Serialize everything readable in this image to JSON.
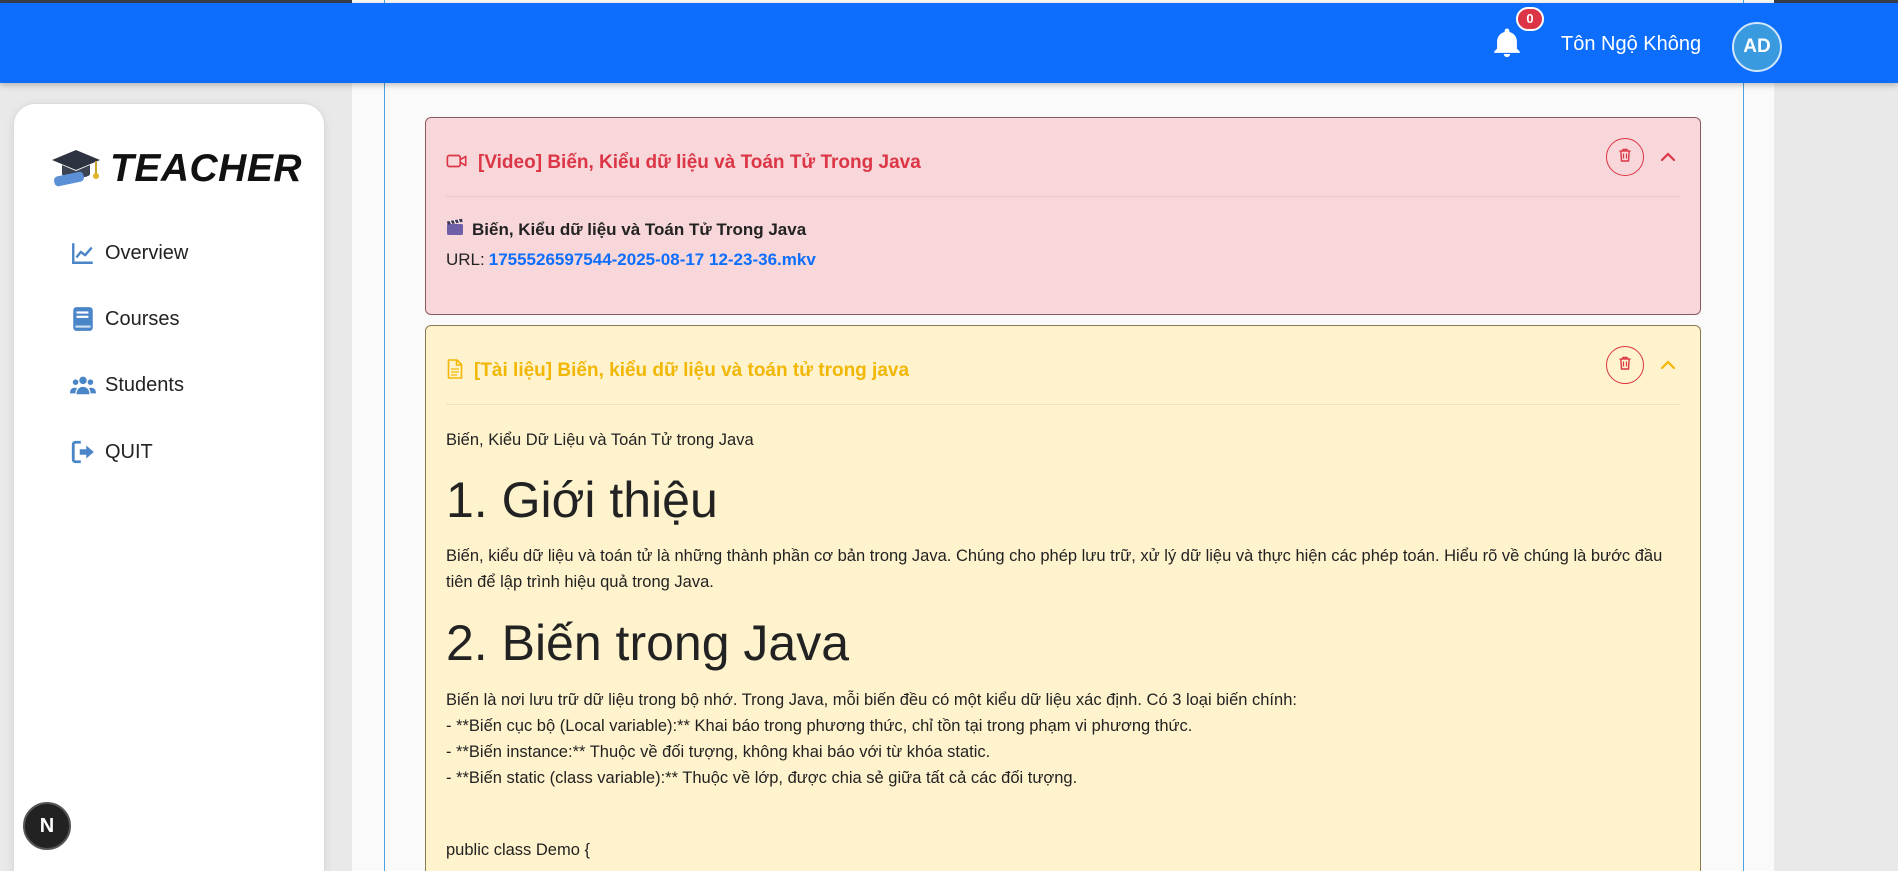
{
  "header": {
    "notification_count": "0",
    "user_name": "Tôn Ngộ Không",
    "avatar_initials": "AD",
    "background_color": "#0d6efd"
  },
  "sidebar": {
    "brand": "TEACHER",
    "items": [
      {
        "label": "Overview",
        "icon": "chart-line-icon"
      },
      {
        "label": "Courses",
        "icon": "book-icon"
      },
      {
        "label": "Students",
        "icon": "users-icon"
      },
      {
        "label": "QUIT",
        "icon": "sign-out-icon"
      }
    ]
  },
  "lessons": {
    "video": {
      "title": "[Video] Biến, Kiểu dữ liệu và Toán Tử Trong Java",
      "name": "Biến, Kiểu dữ liệu và Toán Tử Trong Java",
      "url_label": "URL:",
      "url": "1755526597544-2025-08-17 12-23-36.mkv",
      "color": "#dc3545",
      "background": "#f8d7da"
    },
    "document": {
      "title": "[Tài liệu] Biến, kiểu dữ liệu và toán tử trong java",
      "color": "#f2b705",
      "background": "#fff3cd",
      "intro": "Biến, Kiểu Dữ Liệu và Toán Tử trong Java",
      "heading1": "1. Giới thiệu",
      "para1": "Biến, kiểu dữ liệu và toán tử là những thành phần cơ bản trong Java. Chúng cho phép lưu trữ, xử lý dữ liệu và thực hiện các phép toán. Hiểu rõ về chúng là bước đầu tiên để lập trình hiệu quả trong Java.",
      "heading2": "2. Biến trong Java",
      "para2": "Biến là nơi lưu trữ dữ liệu trong bộ nhớ. Trong Java, mỗi biến đều có một kiểu dữ liệu xác định. Có 3 loại biến chính:",
      "list": [
        "- **Biến cục bộ (Local variable):** Khai báo trong phương thức, chỉ tồn tại trong phạm vi phương thức.",
        "- **Biến instance:** Thuộc về đối tượng, không khai báo với từ khóa static.",
        "- **Biến static (class variable):** Thuộc về lớp, được chia sẻ giữa tất cả các đối tượng."
      ],
      "code_line": "public class Demo {"
    }
  },
  "floating": {
    "next_badge": "N"
  }
}
